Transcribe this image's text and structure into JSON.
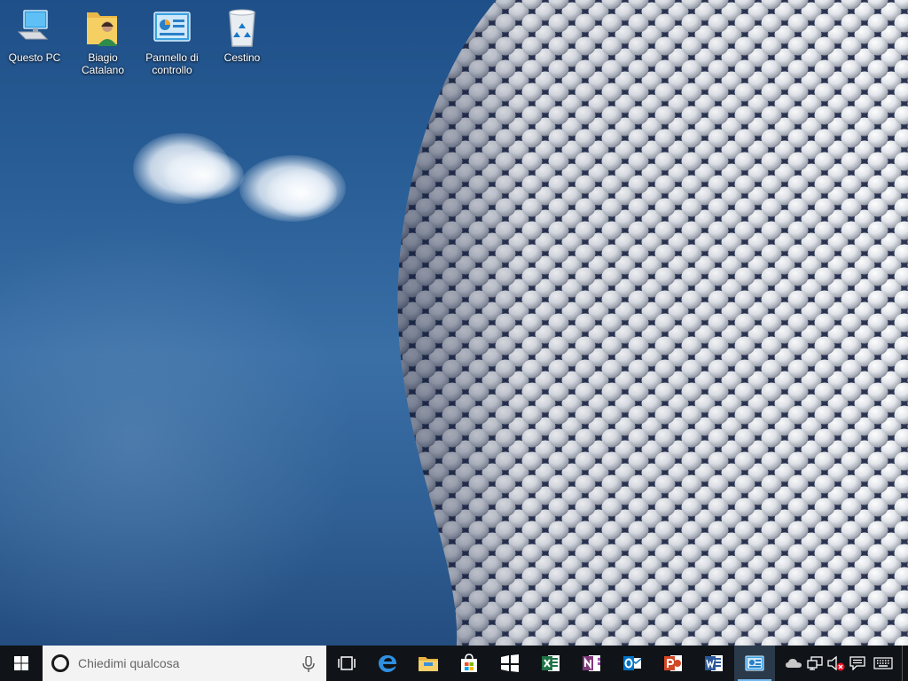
{
  "desktop": {
    "icons": [
      {
        "label": "Questo PC",
        "icon": "computer-icon"
      },
      {
        "label": "Biagio Catalano",
        "icon": "user-folder-icon"
      },
      {
        "label": "Pannello di controllo",
        "icon": "control-panel-icon"
      },
      {
        "label": "Cestino",
        "icon": "recycle-bin-icon"
      }
    ]
  },
  "taskbar": {
    "search": {
      "placeholder": "Chiedimi qualcosa",
      "value": ""
    },
    "apps": [
      {
        "name": "task-view",
        "icon": "task-view-icon"
      },
      {
        "name": "edge",
        "icon": "edge-icon"
      },
      {
        "name": "file-explorer",
        "icon": "folder-icon"
      },
      {
        "name": "store",
        "icon": "store-icon"
      },
      {
        "name": "tablet-app",
        "icon": "app-tiles-icon"
      },
      {
        "name": "excel",
        "icon": "excel-icon"
      },
      {
        "name": "onenote",
        "icon": "onenote-icon"
      },
      {
        "name": "outlook",
        "icon": "outlook-icon"
      },
      {
        "name": "powerpoint",
        "icon": "powerpoint-icon"
      },
      {
        "name": "word",
        "icon": "word-icon"
      },
      {
        "name": "control-panel",
        "icon": "control-panel-icon",
        "active": true
      }
    ],
    "tray": [
      "cloud-icon",
      "network-icon",
      "volume-muted-icon",
      "action-center-icon",
      "keyboard-icon"
    ]
  },
  "colors": {
    "taskbar": "#101418",
    "sky": "#2a5f97",
    "accent": "#76b9ed"
  }
}
